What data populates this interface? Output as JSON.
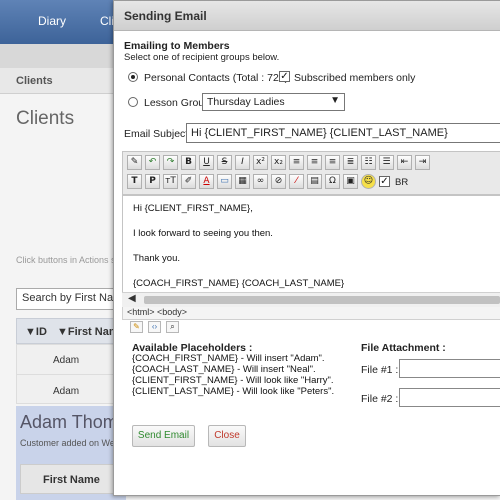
{
  "background": {
    "nav_tabs": [
      "Diary",
      "Cli"
    ],
    "section_label": "Clients",
    "page_title": "Clients",
    "hint_text": "Click buttons in Actions s",
    "search_placeholder": "Search by First Nam",
    "table_headers": [
      "▼ID",
      "▼First Name"
    ],
    "table_rows": [
      "Adam",
      "Adam"
    ],
    "client_name": "Adam Thom",
    "client_sub": "Customer added on We",
    "panel_header": "First Name"
  },
  "dialog": {
    "title": "Sending Email",
    "heading": "Emailing to Members",
    "instruction": "Select one of recipient groups below.",
    "personal_contacts_label": "Personal Contacts (Total : 723)",
    "subscribed_label": "Subscribed members only",
    "lesson_group_label": "Lesson Group",
    "lesson_group_value": "Thursday Ladies",
    "subject_label": "Email Subject :",
    "subject_value": "Hi {CLIENT_FIRST_NAME} {CLIENT_LAST_NAME}",
    "br_label": "BR",
    "body_lines": [
      "Hi {CLIENT_FIRST_NAME},",
      "I look forward to seeing you then.",
      "Thank you.",
      "{COACH_FIRST_NAME} {COACH_LAST_NAME}"
    ],
    "status_path": "<html> <body>",
    "placeholders_title": "Available Placeholders :",
    "placeholders": [
      "{COACH_FIRST_NAME} - Will insert \"Adam\".",
      "{COACH_LAST_NAME} - Will insert \"Neal\".",
      "{CLIENT_FIRST_NAME} - Will look like \"Harry\".",
      "{CLIENT_LAST_NAME} - Will look like \"Peters\"."
    ],
    "attachment_title": "File Attachment :",
    "file1_label": "File #1 :",
    "file2_label": "File #2 :",
    "send_label": "Send Email",
    "close_label": "Close",
    "colors": {
      "send_text": "#2f8a2f",
      "close_text": "#c0392b",
      "nav": "#4a6fa8"
    }
  }
}
